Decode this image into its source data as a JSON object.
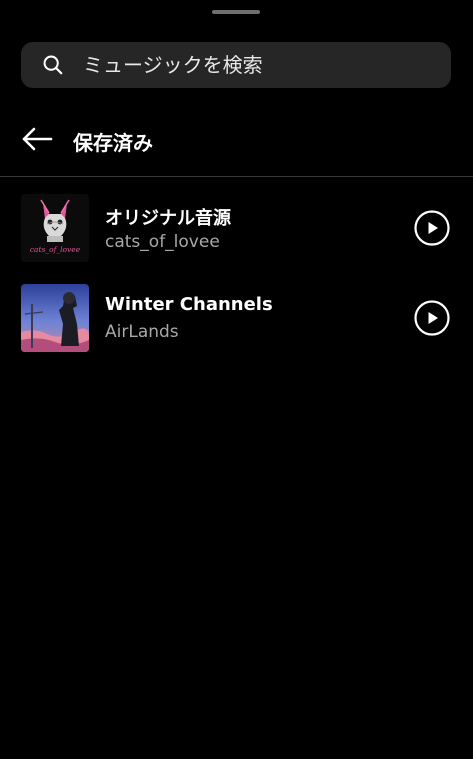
{
  "search": {
    "placeholder": "ミュージックを検索",
    "icon": "search-icon"
  },
  "header": {
    "title": "保存済み",
    "back_icon": "arrow-left-icon"
  },
  "tracks": [
    {
      "title": "オリジナル音源",
      "artist": "cats_of_lovee",
      "thumbnail_caption": "cats_of_lovee"
    },
    {
      "title": "Winter Channels",
      "artist": "AirLands",
      "thumbnail_caption": ""
    }
  ],
  "colors": {
    "background": "#000000",
    "search_bg": "#262626",
    "secondary_text": "#a8a8a8",
    "divider": "#3a3a3a",
    "handle": "#6e6e6e"
  }
}
